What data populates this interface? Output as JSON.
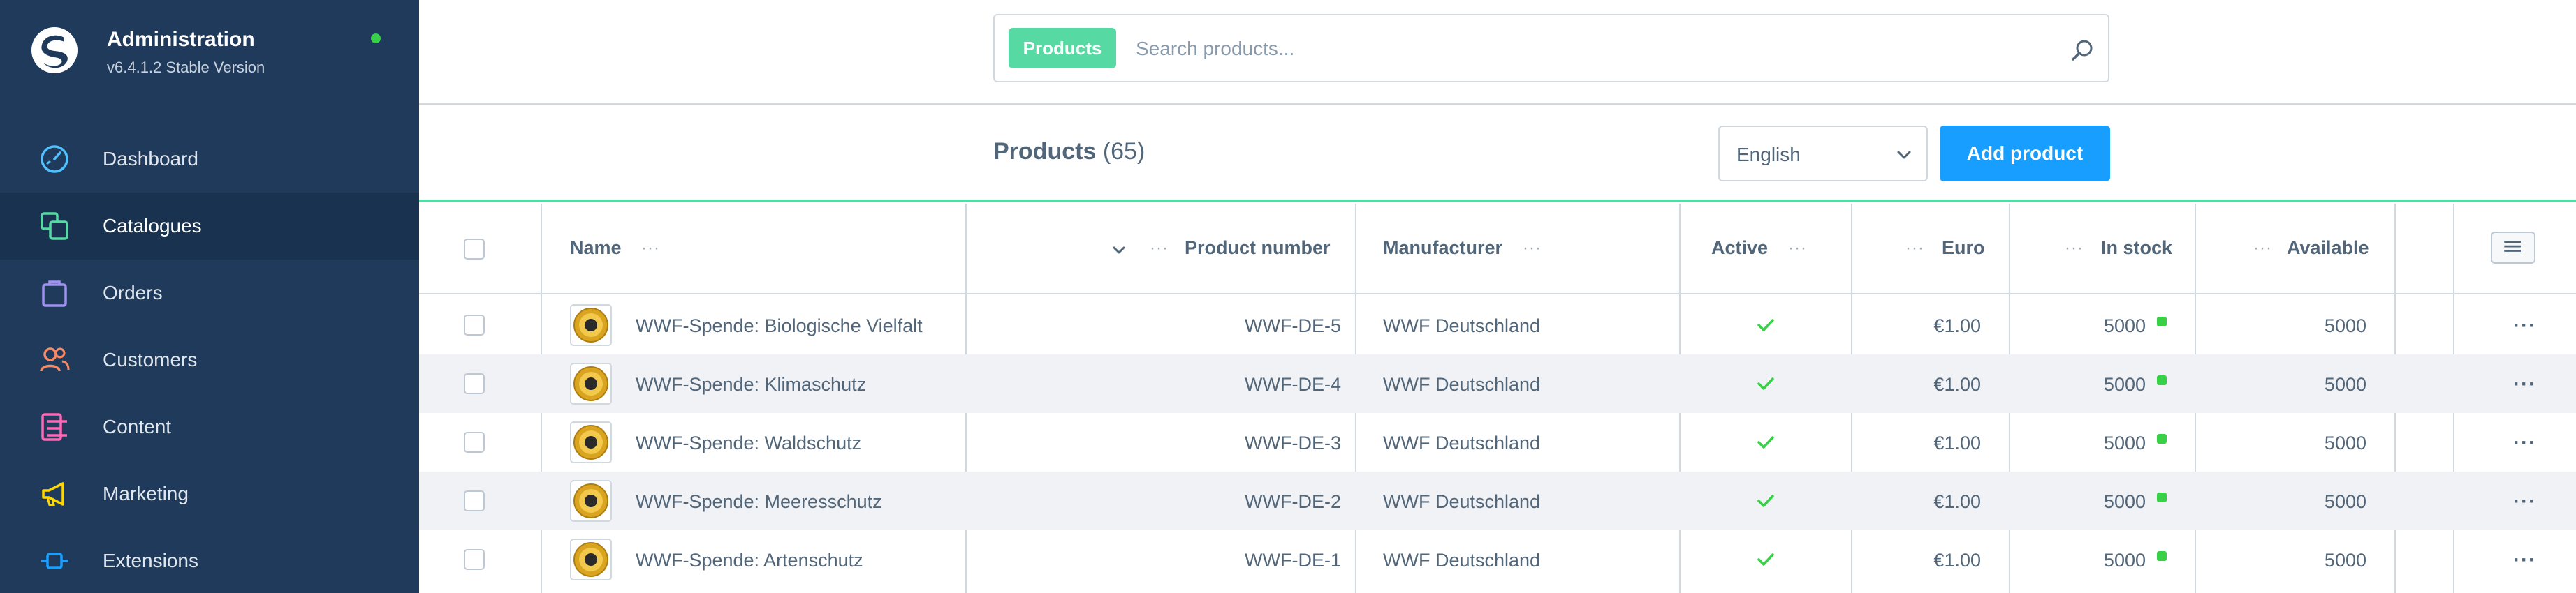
{
  "app": {
    "title": "Administration",
    "version": "v6.4.1.2 Stable Version"
  },
  "sidebar": {
    "items": [
      {
        "label": "Dashboard",
        "icon": "dashboard-gauge-icon",
        "color": "#4fc2ff"
      },
      {
        "label": "Catalogues",
        "icon": "catalogues-icon",
        "color": "#57d9a3",
        "active": true
      },
      {
        "label": "Orders",
        "icon": "orders-bag-icon",
        "color": "#a092f0"
      },
      {
        "label": "Customers",
        "icon": "customers-icon",
        "color": "#f88962"
      },
      {
        "label": "Content",
        "icon": "content-icon",
        "color": "#ff68b4"
      },
      {
        "label": "Marketing",
        "icon": "marketing-megaphone-icon",
        "color": "#ffd700"
      },
      {
        "label": "Extensions",
        "icon": "extensions-plug-icon",
        "color": "#189eff"
      }
    ]
  },
  "search": {
    "type_label": "Products",
    "placeholder": "Search products..."
  },
  "smartbar": {
    "title": "Products",
    "count": "(65)",
    "language": "English",
    "add_label": "Add product"
  },
  "grid": {
    "columns": [
      "Name",
      "Product number",
      "Manufacturer",
      "Active",
      "Euro",
      "In stock",
      "Available"
    ],
    "rows": [
      {
        "name": "WWF-Spende: Biologische Vielfalt",
        "number": "WWF-DE-5",
        "manufacturer": "WWF Deutschland",
        "active": true,
        "price": "€1.00",
        "stock": "5000",
        "available": "5000"
      },
      {
        "name": "WWF-Spende: Klimaschutz",
        "number": "WWF-DE-4",
        "manufacturer": "WWF Deutschland",
        "active": true,
        "price": "€1.00",
        "stock": "5000",
        "available": "5000"
      },
      {
        "name": "WWF-Spende: Waldschutz",
        "number": "WWF-DE-3",
        "manufacturer": "WWF Deutschland",
        "active": true,
        "price": "€1.00",
        "stock": "5000",
        "available": "5000"
      },
      {
        "name": "WWF-Spende: Meeresschutz",
        "number": "WWF-DE-2",
        "manufacturer": "WWF Deutschland",
        "active": true,
        "price": "€1.00",
        "stock": "5000",
        "available": "5000"
      },
      {
        "name": "WWF-Spende: Artenschutz",
        "number": "WWF-DE-1",
        "manufacturer": "WWF Deutschland",
        "active": true,
        "price": "€1.00",
        "stock": "5000",
        "available": "5000"
      }
    ]
  },
  "colors": {
    "sidebar_bg": "#1f3a5a",
    "accent_green": "#57d9a3",
    "primary_blue": "#189eff",
    "status_green": "#37d046"
  }
}
